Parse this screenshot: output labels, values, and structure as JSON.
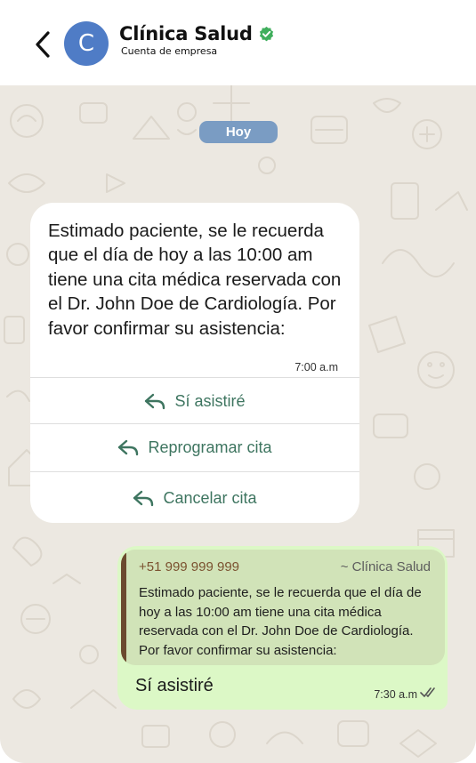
{
  "header": {
    "back_icon": "chevron-left-icon",
    "avatar_letter": "C",
    "avatar_color": "#4f7cc6",
    "title": "Clínica Salud",
    "verified_icon": "verified-check-icon",
    "verified_color": "#3fae5c",
    "subtitle": "Cuenta de empresa"
  },
  "chat": {
    "background_color": "#ece8e1",
    "date_label": "Hoy",
    "incoming": {
      "text": "Estimado paciente, se le recuerda que el día de hoy a las 10:00 am tiene una cita médica reservada con el Dr. John Doe de Cardiología. Por favor confirmar su asistencia:",
      "time": "7:00 a.m",
      "quick_replies": [
        {
          "label": "Sí asistiré",
          "icon": "reply-icon"
        },
        {
          "label": "Reprogramar cita",
          "icon": "reply-icon"
        },
        {
          "label": "Cancelar cita",
          "icon": "reply-icon"
        }
      ]
    },
    "outgoing": {
      "quoted": {
        "phone": "+51 999 999 999",
        "sender": "~ Clínica Salud",
        "text": "Estimado paciente, se le recuerda que el día de hoy a las 10:00 am tiene una cita médica reservada con el Dr. John Doe de Cardiología. Por favor confirmar su asistencia:"
      },
      "text": "Sí asistiré",
      "time": "7:30 a.m",
      "status_icon": "double-check-icon"
    }
  },
  "colors": {
    "accent_green": "#3e7560",
    "bubble_out": "#dcf8c6",
    "quote_bar": "#6b4a2e",
    "date_pill": "#7a9cc3"
  }
}
